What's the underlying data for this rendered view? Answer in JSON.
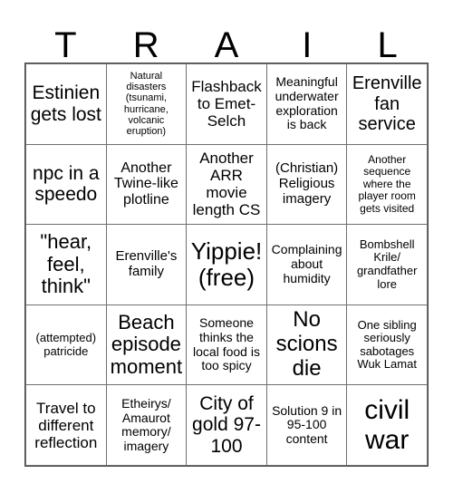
{
  "header": {
    "letters": [
      "T",
      "R",
      "A",
      "I",
      "L"
    ]
  },
  "grid": {
    "columns": 5,
    "rows": 5,
    "cells": [
      {
        "text": "Estinien gets lost",
        "font_size": 21
      },
      {
        "text": "Natural disasters (tsunami, hurricane, volcanic eruption)",
        "font_size": 11
      },
      {
        "text": "Flashback to Emet-Selch",
        "font_size": 17
      },
      {
        "text": "Meaningful underwater exploration is back",
        "font_size": 14
      },
      {
        "text": "Erenville fan service",
        "font_size": 20
      },
      {
        "text": "npc in a speedo",
        "font_size": 21
      },
      {
        "text": "Another Twine-like plotline",
        "font_size": 16
      },
      {
        "text": "Another ARR movie length CS",
        "font_size": 17
      },
      {
        "text": "(Christian) Religious imagery",
        "font_size": 15
      },
      {
        "text": "Another sequence where the player room gets visited",
        "font_size": 12
      },
      {
        "text": "\"hear, feel, think\"",
        "font_size": 22
      },
      {
        "text": "Erenville's family",
        "font_size": 15
      },
      {
        "text": "Yippie! (free)",
        "font_size": 26
      },
      {
        "text": "Complaining about humidity",
        "font_size": 14
      },
      {
        "text": "Bombshell Krile/ grandfather lore",
        "font_size": 13
      },
      {
        "text": "(attempted) patricide",
        "font_size": 13
      },
      {
        "text": "Beach episode moment",
        "font_size": 22
      },
      {
        "text": "Someone thinks the local food is too spicy",
        "font_size": 14
      },
      {
        "text": "No scions die",
        "font_size": 24
      },
      {
        "text": "One sibling seriously sabotages Wuk Lamat",
        "font_size": 13
      },
      {
        "text": "Travel to different reflection",
        "font_size": 17
      },
      {
        "text": "Etheirys/ Amaurot memory/ imagery",
        "font_size": 14
      },
      {
        "text": "City of gold 97-100",
        "font_size": 21
      },
      {
        "text": "Solution 9 in 95-100 content",
        "font_size": 14
      },
      {
        "text": "civil war",
        "font_size": 30
      }
    ]
  },
  "colors": {
    "background": "#ffffff",
    "text": "#000000",
    "grid_line": "#6f6f6f",
    "frame": "#4a4a4a"
  }
}
